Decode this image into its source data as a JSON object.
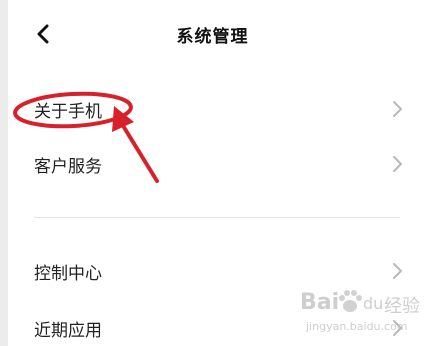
{
  "header": {
    "back_icon": "chevron-left-icon",
    "title": "系统管理"
  },
  "menu": {
    "group1": [
      {
        "label": "关于手机",
        "icon": "chevron-right-icon"
      },
      {
        "label": "客户服务",
        "icon": "chevron-right-icon"
      }
    ],
    "group2": [
      {
        "label": "控制中心",
        "icon": "chevron-right-icon"
      },
      {
        "label": "近期应用",
        "icon": "chevron-right-icon"
      }
    ]
  },
  "annotation": {
    "color": "#d8202a",
    "target": "关于手机"
  },
  "watermark": {
    "brand": "Bai",
    "brand2": "du",
    "suffix": "经验",
    "url": "jingyan.baidu.com"
  },
  "colors": {
    "text": "#222222",
    "chevron": "#b8b8b8",
    "divider": "#e2e2e2",
    "annotation_red": "#d8202a"
  }
}
